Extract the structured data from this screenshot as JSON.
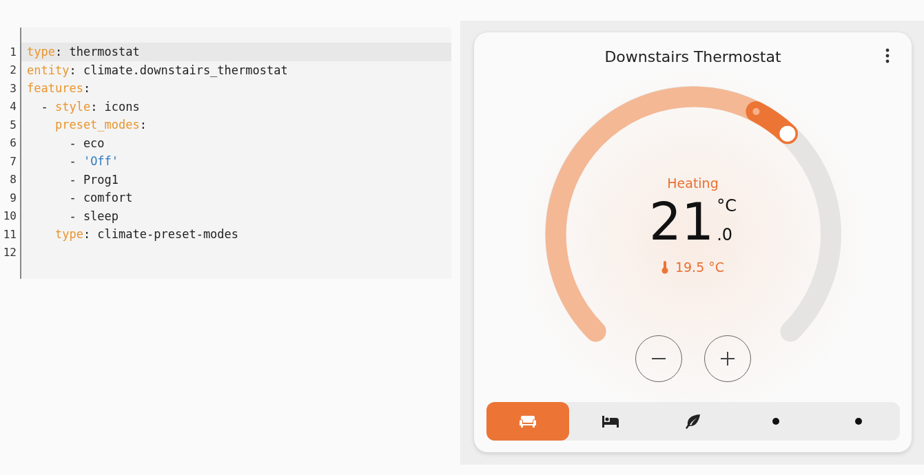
{
  "editor": {
    "lines": [
      {
        "number": "1",
        "highlighted": true,
        "tokens": [
          {
            "kind": "key",
            "text": "type"
          },
          {
            "kind": "plain",
            "text": ": thermostat"
          }
        ]
      },
      {
        "number": "2",
        "highlighted": false,
        "tokens": [
          {
            "kind": "key",
            "text": "entity"
          },
          {
            "kind": "plain",
            "text": ": climate.downstairs_thermostat"
          }
        ]
      },
      {
        "number": "3",
        "highlighted": false,
        "tokens": [
          {
            "kind": "key",
            "text": "features"
          },
          {
            "kind": "plain",
            "text": ":"
          }
        ]
      },
      {
        "number": "4",
        "highlighted": false,
        "tokens": [
          {
            "kind": "plain",
            "text": "  - "
          },
          {
            "kind": "key",
            "text": "style"
          },
          {
            "kind": "plain",
            "text": ": icons"
          }
        ]
      },
      {
        "number": "5",
        "highlighted": false,
        "tokens": [
          {
            "kind": "key",
            "text": "    preset_modes"
          },
          {
            "kind": "plain",
            "text": ":"
          }
        ]
      },
      {
        "number": "6",
        "highlighted": false,
        "tokens": [
          {
            "kind": "plain",
            "text": "      - eco"
          }
        ]
      },
      {
        "number": "7",
        "highlighted": false,
        "tokens": [
          {
            "kind": "plain",
            "text": "      - "
          },
          {
            "kind": "string",
            "text": "'Off'"
          }
        ]
      },
      {
        "number": "8",
        "highlighted": false,
        "tokens": [
          {
            "kind": "plain",
            "text": "      - Prog1"
          }
        ]
      },
      {
        "number": "9",
        "highlighted": false,
        "tokens": [
          {
            "kind": "plain",
            "text": "      - comfort"
          }
        ]
      },
      {
        "number": "10",
        "highlighted": false,
        "tokens": [
          {
            "kind": "plain",
            "text": "      - sleep"
          }
        ]
      },
      {
        "number": "11",
        "highlighted": false,
        "tokens": [
          {
            "kind": "key",
            "text": "    type"
          },
          {
            "kind": "plain",
            "text": ": climate-preset-modes"
          }
        ]
      },
      {
        "number": "12",
        "highlighted": false
      }
    ]
  },
  "card": {
    "title": "Downstairs Thermostat",
    "dial": {
      "action": "Heating",
      "target_whole": "21",
      "target_decimal": ".0",
      "unit": "°C",
      "current": "19.5 °C"
    },
    "modes": [
      {
        "kind": "sofa",
        "selected": true
      },
      {
        "kind": "bed",
        "selected": false
      },
      {
        "kind": "leaf",
        "selected": false
      },
      {
        "kind": "dot",
        "selected": false
      },
      {
        "kind": "dot",
        "selected": false
      }
    ]
  }
}
